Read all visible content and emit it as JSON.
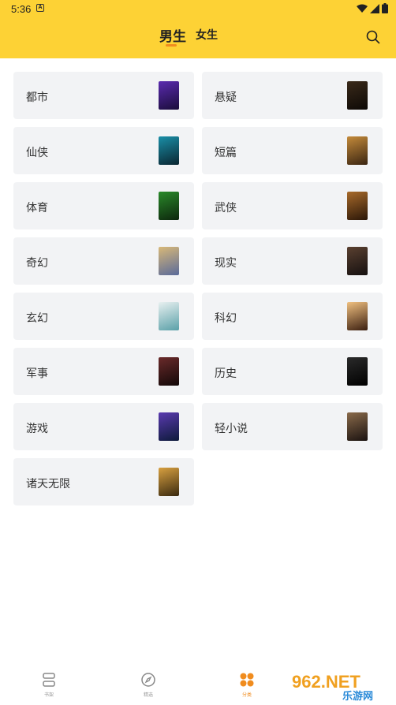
{
  "status_bar": {
    "time": "5:36",
    "notification_icon": "A"
  },
  "header": {
    "tabs": [
      {
        "label": "男生",
        "active": true
      },
      {
        "label": "女生",
        "active": false
      }
    ],
    "search_icon": "search-icon"
  },
  "categories": [
    {
      "label": "都市",
      "cover_colors": [
        "#5b2bb0",
        "#1a0d3a"
      ]
    },
    {
      "label": "悬疑",
      "cover_colors": [
        "#3a2a1a",
        "#0d0906"
      ]
    },
    {
      "label": "仙侠",
      "cover_colors": [
        "#1a8fa8",
        "#0a2530"
      ]
    },
    {
      "label": "短篇",
      "cover_colors": [
        "#c48a3a",
        "#3a2512"
      ]
    },
    {
      "label": "体育",
      "cover_colors": [
        "#2a8a2a",
        "#0d260d"
      ]
    },
    {
      "label": "武侠",
      "cover_colors": [
        "#a86a2a",
        "#2a1608"
      ]
    },
    {
      "label": "奇幻",
      "cover_colors": [
        "#d8b878",
        "#5a6a9a"
      ]
    },
    {
      "label": "现实",
      "cover_colors": [
        "#5a4030",
        "#151010"
      ]
    },
    {
      "label": "玄幻",
      "cover_colors": [
        "#e8f0f0",
        "#5aa0a8"
      ]
    },
    {
      "label": "科幻",
      "cover_colors": [
        "#f0c080",
        "#3a1e10"
      ]
    },
    {
      "label": "军事",
      "cover_colors": [
        "#6a2a2a",
        "#120808"
      ]
    },
    {
      "label": "历史",
      "cover_colors": [
        "#2a2a2a",
        "#000000"
      ]
    },
    {
      "label": "游戏",
      "cover_colors": [
        "#5a3ab0",
        "#0d1a3a"
      ]
    },
    {
      "label": "轻小说",
      "cover_colors": [
        "#8a6a4a",
        "#1a1210"
      ]
    },
    {
      "label": "诸天无限",
      "cover_colors": [
        "#d8a040",
        "#3a2a10"
      ]
    }
  ],
  "bottom_nav": [
    {
      "label": "书架",
      "icon": "bookshelf-icon",
      "active": false
    },
    {
      "label": "精选",
      "icon": "compass-icon",
      "active": false
    },
    {
      "label": "分类",
      "icon": "category-icon",
      "active": true
    }
  ],
  "watermark": {
    "text": "962.NET",
    "subtext": "乐游网"
  },
  "colors": {
    "header_bg": "#fdd235",
    "accent": "#f08c1e",
    "card_bg": "#f2f3f5"
  }
}
